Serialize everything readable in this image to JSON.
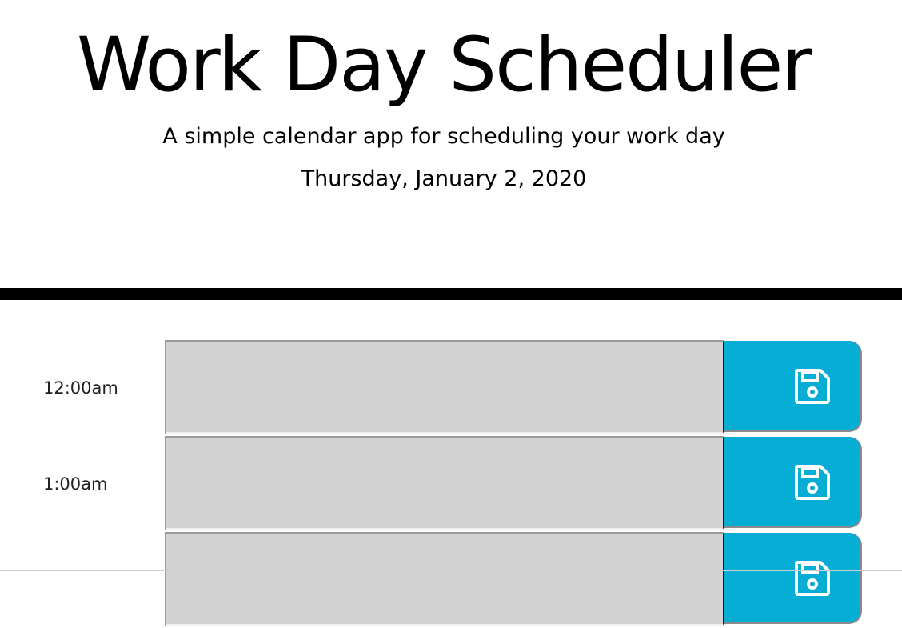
{
  "header": {
    "title": "Work Day Scheduler",
    "subtitle": "A simple calendar app for scheduling your work day",
    "current_date": "Thursday, January 2, 2020"
  },
  "time_blocks": [
    {
      "hour": "12:00am",
      "text": "",
      "save_icon": "floppy-disk-icon"
    },
    {
      "hour": "1:00am",
      "text": "",
      "save_icon": "floppy-disk-icon"
    },
    {
      "hour": "",
      "text": "",
      "save_icon": "floppy-disk-icon"
    }
  ],
  "colors": {
    "save_button": "#06aed5",
    "past_block": "#d3d3d3",
    "divider": "#000000"
  }
}
